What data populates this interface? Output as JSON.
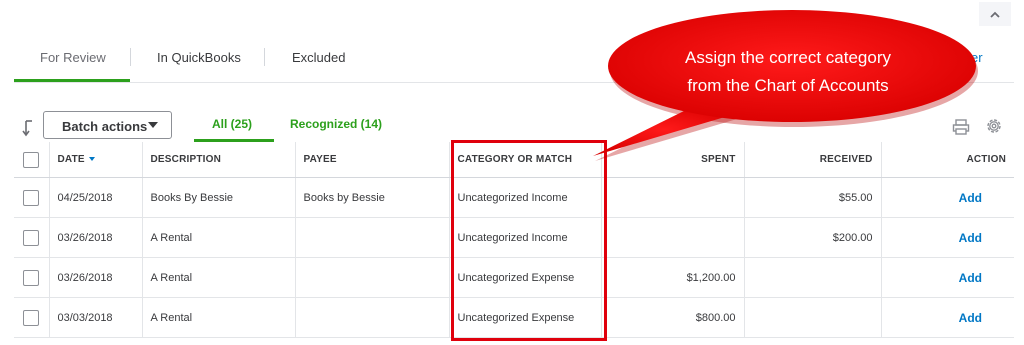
{
  "tabs": [
    {
      "label": "For Review"
    },
    {
      "label": "In QuickBooks"
    },
    {
      "label": "Excluded"
    }
  ],
  "register_link": "ister",
  "toolbar": {
    "batch_label": "Batch actions",
    "subtabs": [
      {
        "label": "All (25)"
      },
      {
        "label": "Recognized (14)"
      }
    ]
  },
  "table": {
    "headers": {
      "date": "DATE",
      "description": "DESCRIPTION",
      "payee": "PAYEE",
      "category": "CATEGORY OR MATCH",
      "spent": "SPENT",
      "received": "RECEIVED",
      "action": "ACTION"
    },
    "rows": [
      {
        "date": "04/25/2018",
        "description": "Books By Bessie",
        "payee": "Books by Bessie",
        "category": "Uncategorized Income",
        "spent": "",
        "received": "$55.00",
        "action": "Add"
      },
      {
        "date": "03/26/2018",
        "description": "A Rental",
        "payee": "",
        "category": "Uncategorized Income",
        "spent": "",
        "received": "$200.00",
        "action": "Add"
      },
      {
        "date": "03/26/2018",
        "description": "A Rental",
        "payee": "",
        "category": "Uncategorized Expense",
        "spent": "$1,200.00",
        "received": "",
        "action": "Add"
      },
      {
        "date": "03/03/2018",
        "description": "A Rental",
        "payee": "",
        "category": "Uncategorized Expense",
        "spent": "$800.00",
        "received": "",
        "action": "Add"
      }
    ]
  },
  "callout": {
    "line1": "Assign the correct category",
    "line2": "from the Chart of Accounts"
  },
  "colors": {
    "accent_green": "#2ca01c",
    "link_blue": "#0077c5",
    "highlight_red": "#e0000c"
  },
  "icons": [
    "chevron-up-icon",
    "sort-arrow-icon",
    "caret-down-icon",
    "print-icon",
    "gear-icon"
  ]
}
